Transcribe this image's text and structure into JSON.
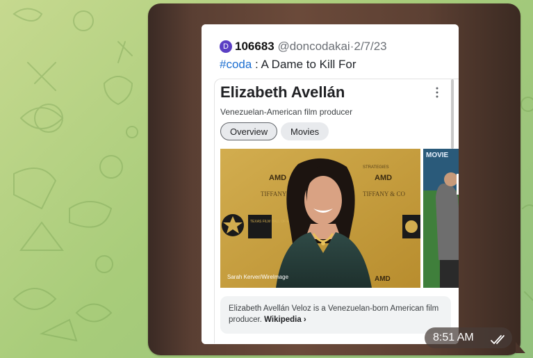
{
  "message": {
    "time": "8:51 AM",
    "read_status_icon": "double-check-icon"
  },
  "tweet": {
    "avatar_letter": "D",
    "name": "106683",
    "handle": "@doncodakai",
    "separator": "·",
    "date": "2/7/23",
    "hashtag": "#coda",
    "text": " : A Dame to Kill For"
  },
  "knowledge_card": {
    "title": "Elizabeth Avellán",
    "subtitle": "Venezuelan-American film producer",
    "more_icon": "kebab-menu-icon",
    "tabs": [
      {
        "label": "Overview",
        "active": true
      },
      {
        "label": "Movies",
        "active": false
      }
    ],
    "photo_credit": "Sarah Kerver/WireImage",
    "backdrop_texts": {
      "amd_left": "AMD",
      "amd_right": "AMD",
      "tiffany_left": "TIFFANY",
      "tiffany_right": "TIFFANY & CO",
      "texas_film": "TEXAS FILM HALL OF FAME",
      "strategies": "STRATEGIES",
      "movie": "MOVIE"
    },
    "description": "Elizabeth Avellán Veloz is a Venezuelan-born American film producer. ",
    "source_link": "Wikipedia ›"
  },
  "colors": {
    "chat_background": "#a8cc7a",
    "hashtag": "#1d6fd1",
    "avatar": "#5b3fc4"
  }
}
